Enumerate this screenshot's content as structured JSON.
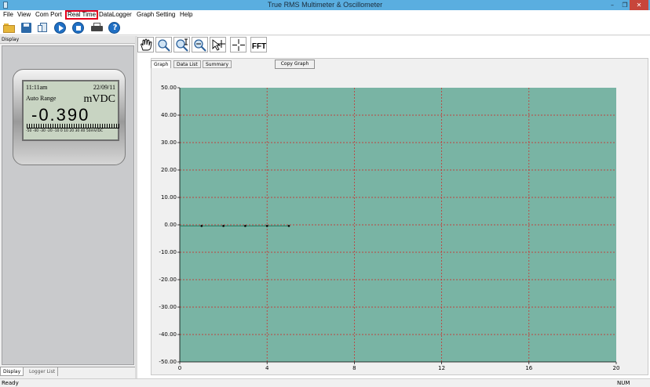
{
  "window": {
    "title": "True RMS Multimeter & Oscillometer",
    "min": "–",
    "max": "❐",
    "close": "✕"
  },
  "menu": [
    "File",
    "View",
    "Com Port",
    "Real Time",
    "DataLogger",
    "Graph Setting",
    "Help"
  ],
  "menu_highlighted": "Real Time",
  "toolbar_icons": [
    "open-folder-icon",
    "save-disk-icon",
    "copy-icon",
    "play-icon",
    "stop-icon",
    "print-icon",
    "help-icon"
  ],
  "help_glyph": "?",
  "left_panel": {
    "label": "Display",
    "meter": {
      "time": "11:11am",
      "date": "22/09/11",
      "range": "Auto Range",
      "unit": "mVDC",
      "value": "-0.390",
      "scale": "-50 -40 -30 -20 -10  0  10  20  30  40  50mV/DC"
    },
    "bottom_tabs": [
      "Display",
      "Logger List"
    ]
  },
  "graph_toolbar_icons": [
    "hand-pan-icon",
    "zoom-in-icon",
    "zoom-vertical-icon",
    "zoom-out-icon",
    "cursor-crosshair-icon",
    "marker-crosshair-icon",
    "fft-icon"
  ],
  "fft_label": "FFT",
  "graph_tabs": [
    "Graph",
    "Data List",
    "Summary"
  ],
  "copy_graph_button": "Copy Graph",
  "colors": {
    "plot_bg": "#79b4a4",
    "grid": "#d42020",
    "series": "#1a7e64"
  },
  "chart_data": {
    "type": "line",
    "title": "",
    "xlabel": "",
    "ylabel": "",
    "xlim": [
      0,
      20
    ],
    "ylim": [
      -50,
      50
    ],
    "x_ticks": [
      0,
      4,
      8,
      12,
      16,
      20
    ],
    "y_ticks": [
      50,
      40,
      30,
      20,
      10,
      0,
      -10,
      -20,
      -30,
      -40,
      -50
    ],
    "x_tick_labels": [
      "0",
      "4",
      "8",
      "12",
      "16",
      "20"
    ],
    "y_tick_labels": [
      "50.00",
      "40.00",
      "30.00",
      "20.00",
      "10.00",
      "0.00",
      "-10.00",
      "-20.00",
      "-30.00",
      "-40.00",
      "-50.00"
    ],
    "grid": true,
    "series": [
      {
        "x": [
          0,
          1,
          2,
          3,
          4,
          5
        ],
        "y": [
          -0.39,
          -0.39,
          -0.39,
          -0.39,
          -0.39,
          -0.39
        ]
      }
    ],
    "markers_at": [
      1,
      2,
      3,
      4,
      5
    ]
  },
  "status": {
    "left": "Ready",
    "right": "NUM"
  }
}
